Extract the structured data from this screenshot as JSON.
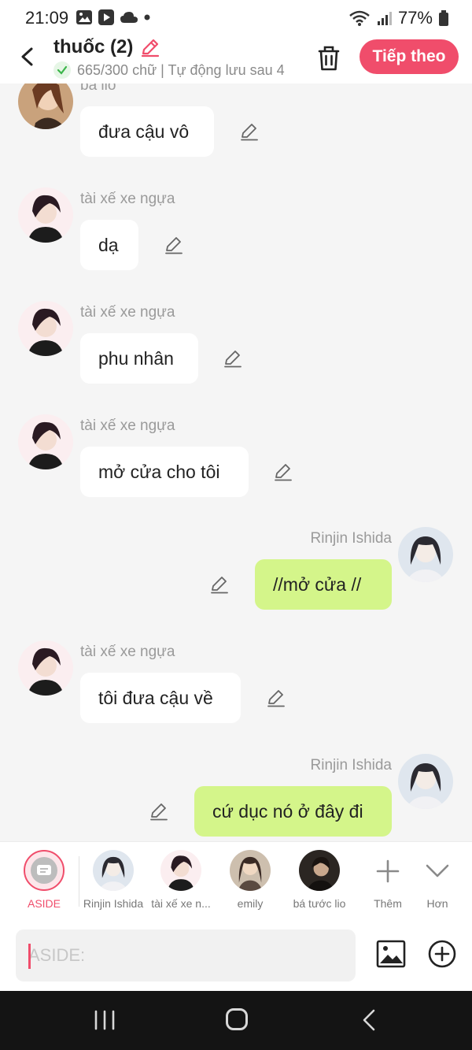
{
  "status": {
    "time": "21:09",
    "battery": "77%",
    "icons": [
      "gallery-icon",
      "media-icon",
      "cloud-icon",
      "dot-icon",
      "wifi-icon",
      "signal-icon",
      "battery-icon"
    ]
  },
  "header": {
    "title": "thuốc (2)",
    "subtitle": "665/300 chữ | Tự động lưu sau 4",
    "next_label": "Tiếp theo",
    "accent": "#f04d6b"
  },
  "messages": [
    {
      "sender": "bá lio",
      "text": "đưa cậu vô",
      "side": "left",
      "avatar": "lio"
    },
    {
      "sender": "tài xế xe ngựa",
      "text": "dạ",
      "side": "left",
      "avatar": "driver"
    },
    {
      "sender": "tài xế xe ngựa",
      "text": "phu nhân",
      "side": "left",
      "avatar": "driver"
    },
    {
      "sender": "tài xế xe ngựa",
      "text": "mở cửa cho tôi",
      "side": "left",
      "avatar": "driver"
    },
    {
      "sender": "Rinjin Ishida",
      "text": "//mở cửa //",
      "side": "right",
      "avatar": "rinjin"
    },
    {
      "sender": "tài xế xe ngựa",
      "text": "tôi đưa cậu về",
      "side": "left",
      "avatar": "driver"
    },
    {
      "sender": "Rinjin Ishida",
      "text": "cứ dục nó ở đây đi",
      "side": "right",
      "avatar": "rinjin"
    }
  ],
  "character_bar": {
    "items": [
      {
        "label": "ASIDE"
      },
      {
        "label": "Rinjin Ishida"
      },
      {
        "label": "tài xế xe n..."
      },
      {
        "label": "emily"
      },
      {
        "label": "bá tước lio"
      },
      {
        "label": "Thêm"
      },
      {
        "label": "Hơn"
      }
    ]
  },
  "composer": {
    "placeholder": "ASIDE:"
  },
  "colors": {
    "my_bubble": "#d4f58a",
    "other_bubble": "#ffffff",
    "background": "#f5f5f5"
  }
}
